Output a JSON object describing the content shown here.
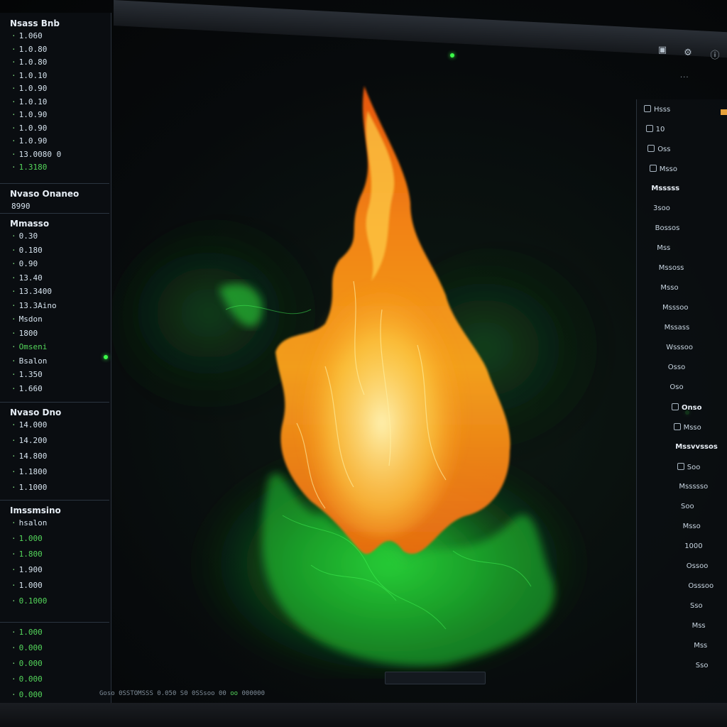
{
  "left_panel": {
    "sections": [
      {
        "title": "Nsass Bnb",
        "rows": [
          {
            "text": "1.060",
            "green": false
          },
          {
            "text": "1.0.80",
            "green": false
          },
          {
            "text": "1.0.80",
            "green": false
          },
          {
            "text": "1.0.10",
            "green": false
          },
          {
            "text": "1.0.90",
            "green": false
          },
          {
            "text": "1.0.10",
            "green": false
          },
          {
            "text": "1.0.90",
            "green": false
          },
          {
            "text": "1.0.90",
            "green": false
          },
          {
            "text": "1.0.90",
            "green": false
          },
          {
            "text": "13.0080 0",
            "green": false
          },
          {
            "text": "1.3180",
            "green": true
          }
        ]
      },
      {
        "title": "Nvaso Onaneo",
        "subtitle": "8990",
        "rows": []
      },
      {
        "title": "Mmasso",
        "rows": [
          {
            "text": "0.30",
            "green": false
          },
          {
            "text": "0.180",
            "green": false
          },
          {
            "text": "0.90",
            "green": false
          },
          {
            "text": "13.40",
            "green": false
          },
          {
            "text": "13.3400",
            "green": false
          },
          {
            "text": "13.3Aino",
            "green": false
          },
          {
            "text": "Msdon",
            "green": false
          },
          {
            "text": "1800",
            "green": false
          },
          {
            "text": "Omseni",
            "green": true
          },
          {
            "text": "Bsalon",
            "green": false
          },
          {
            "text": "1.350",
            "green": false
          },
          {
            "text": "1.660",
            "green": false
          }
        ]
      },
      {
        "title": "Nvaso Dno",
        "rows": [
          {
            "text": "14.000",
            "green": false
          },
          {
            "text": "14.200",
            "green": false
          },
          {
            "text": "14.800",
            "green": false
          },
          {
            "text": "1.1800",
            "green": false
          },
          {
            "text": "1.1000",
            "green": false
          }
        ]
      },
      {
        "title": "Imssmsino",
        "rows": [
          {
            "text": "hsalon",
            "green": false
          },
          {
            "text": "1.000",
            "green": true
          },
          {
            "text": "1.800",
            "green": true
          },
          {
            "text": "1.900",
            "green": false
          },
          {
            "text": "1.000",
            "green": false
          },
          {
            "text": "0.1000",
            "green": true
          }
        ]
      },
      {
        "title": "",
        "rows": [
          {
            "text": "1.000",
            "green": true
          },
          {
            "text": "0.000",
            "green": true
          },
          {
            "text": "0.000",
            "green": true
          },
          {
            "text": "0.000",
            "green": true
          },
          {
            "text": "0.000",
            "green": true
          }
        ]
      }
    ]
  },
  "right_panel": {
    "rows": [
      {
        "text": "Hsss",
        "bold": false,
        "check": true
      },
      {
        "text": "10",
        "bold": false,
        "check": true
      },
      {
        "text": "Oss",
        "bold": false,
        "check": true
      },
      {
        "text": "Msso",
        "bold": false,
        "check": true
      },
      {
        "text": "Msssss",
        "bold": true,
        "check": false
      },
      {
        "text": "3soo",
        "bold": false,
        "check": false
      },
      {
        "text": "Bossos",
        "bold": false,
        "check": false
      },
      {
        "text": "Mss",
        "bold": false,
        "check": false
      },
      {
        "text": "Mssoss",
        "bold": false,
        "check": false
      },
      {
        "text": "Msso",
        "bold": false,
        "check": false
      },
      {
        "text": "Msssoo",
        "bold": false,
        "check": false
      },
      {
        "text": "Mssass",
        "bold": false,
        "check": false
      },
      {
        "text": "Wsssoo",
        "bold": false,
        "check": false
      },
      {
        "text": "Osso",
        "bold": false,
        "check": false
      },
      {
        "text": "Oso",
        "bold": false,
        "check": false
      },
      {
        "text": "Onso",
        "bold": true,
        "check": true
      },
      {
        "text": "Msso",
        "bold": false,
        "check": true
      },
      {
        "text": "Mssvvssos",
        "bold": true,
        "check": false
      },
      {
        "text": "Soo",
        "bold": false,
        "check": true
      },
      {
        "text": "Mssssso",
        "bold": false,
        "check": false
      },
      {
        "text": "Soo",
        "bold": false,
        "check": false
      },
      {
        "text": "Msso",
        "bold": false,
        "check": false
      },
      {
        "text": "1000",
        "bold": false,
        "check": false
      },
      {
        "text": "Ossoo",
        "bold": false,
        "check": false
      },
      {
        "text": "Osssoo",
        "bold": false,
        "check": false
      },
      {
        "text": "Sso",
        "bold": false,
        "check": false
      },
      {
        "text": "Mss",
        "bold": false,
        "check": false
      },
      {
        "text": "Mss",
        "bold": false,
        "check": false
      },
      {
        "text": "Sso",
        "bold": false,
        "check": false
      }
    ]
  },
  "toolbar": {
    "icons": [
      "camera-icon",
      "settings-icon",
      "info-icon"
    ],
    "hint": "···"
  },
  "status_bar": {
    "text": "Goso 0SSTOMSSS 0.050 S0 0SSsoo 00",
    "ok_text": "oo",
    "tail": "000000"
  },
  "colors": {
    "flame_core": "#fff2a0",
    "flame_mid": "#ffb42a",
    "flame_outer": "#f06a10",
    "smoke_green": "#3cff4a",
    "panel_bg": "#0a0d11"
  }
}
